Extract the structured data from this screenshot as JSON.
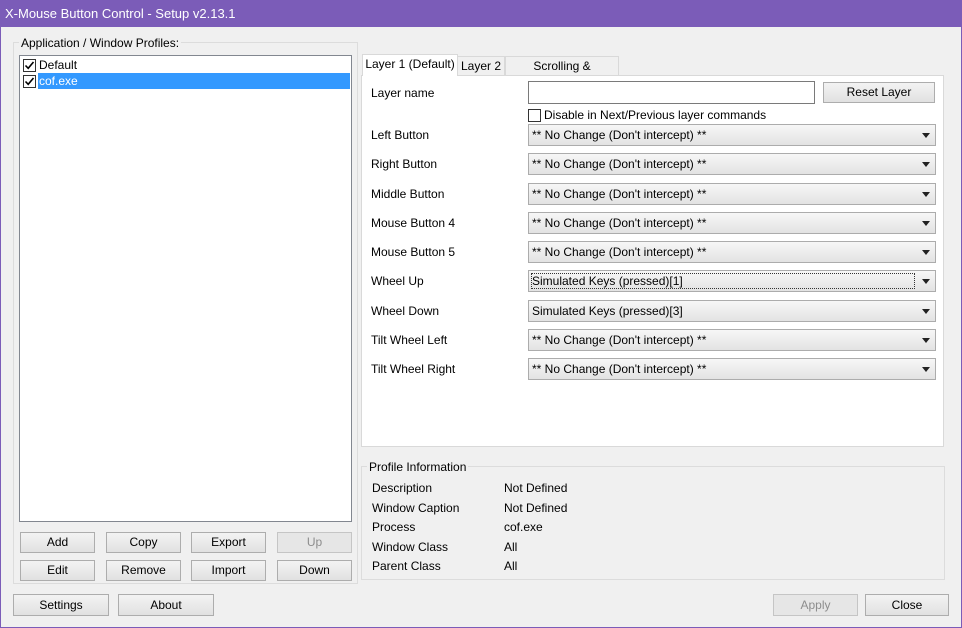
{
  "window": {
    "title": "X-Mouse Button Control - Setup v2.13.1"
  },
  "profiles": {
    "group_title": "Application / Window Profiles:",
    "items": [
      {
        "label": "Default",
        "checked": true,
        "selected": false
      },
      {
        "label": "cof.exe",
        "checked": true,
        "selected": true
      }
    ],
    "buttons": {
      "add": "Add",
      "copy": "Copy",
      "export": "Export",
      "up": "Up",
      "edit": "Edit",
      "remove": "Remove",
      "import": "Import",
      "down": "Down"
    }
  },
  "tabs": [
    {
      "label": "Layer 1 (Default)",
      "active": true
    },
    {
      "label": "Layer 2",
      "active": false
    },
    {
      "label": "Scrolling & Navigation",
      "active": false
    }
  ],
  "layer": {
    "name_label": "Layer name",
    "name_value": "",
    "reset_label": "Reset Layer",
    "disable_label": "Disable in Next/Previous layer commands",
    "disable_checked": false,
    "rows": [
      {
        "label": "Left Button",
        "value": "** No Change (Don't intercept) **"
      },
      {
        "label": "Right Button",
        "value": "** No Change (Don't intercept) **"
      },
      {
        "label": "Middle Button",
        "value": "** No Change (Don't intercept) **"
      },
      {
        "label": "Mouse Button 4",
        "value": "** No Change (Don't intercept) **"
      },
      {
        "label": "Mouse Button 5",
        "value": "** No Change (Don't intercept) **"
      },
      {
        "label": "Wheel Up",
        "value": "Simulated Keys (pressed)[1]"
      },
      {
        "label": "Wheel Down",
        "value": "Simulated Keys (pressed)[3]"
      },
      {
        "label": "Tilt Wheel Left",
        "value": "** No Change (Don't intercept) **"
      },
      {
        "label": "Tilt Wheel Right",
        "value": "** No Change (Don't intercept) **"
      }
    ]
  },
  "profile_info": {
    "title": "Profile Information",
    "rows": [
      {
        "label": "Description",
        "value": "Not Defined"
      },
      {
        "label": "Window Caption",
        "value": "Not Defined"
      },
      {
        "label": "Process",
        "value": "cof.exe"
      },
      {
        "label": "Window Class",
        "value": "All"
      },
      {
        "label": "Parent Class",
        "value": "All"
      }
    ]
  },
  "footer": {
    "settings": "Settings",
    "about": "About",
    "apply": "Apply",
    "close": "Close"
  },
  "colors": {
    "titlebar": "#7b5cb8",
    "selection": "#3399ff"
  }
}
